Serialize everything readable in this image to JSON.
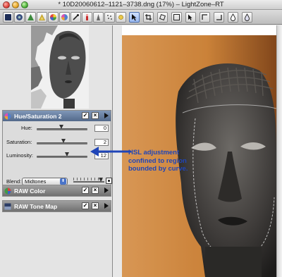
{
  "window": {
    "title": "* 10D20060612–1121–3738.dng (17%) – LightZone–RT"
  },
  "toolbar": {
    "left_tools": [
      "layers-icon",
      "channel-mixer-icon",
      "tone-curve-icon",
      "zone-mapper-icon",
      "color-balance-icon",
      "hue-saturation-icon",
      "color-picker-icon",
      "red-eye-icon",
      "sharpen-icon",
      "noise-icon",
      "relight-icon"
    ],
    "right_tools": [
      "arrow-select-icon",
      "crop-icon",
      "rotate-icon",
      "region-icon",
      "curve-region-icon",
      "polygon-region-icon",
      "spot-icon",
      "drop-icon",
      "drop-outline-icon"
    ]
  },
  "hue_saturation_panel": {
    "title": "Hue/Saturation 2",
    "checked": true,
    "hue": {
      "label": "Hue:",
      "value": "0"
    },
    "saturation": {
      "label": "Saturation:",
      "value": "2"
    },
    "luminosity": {
      "label": "Luminosity:",
      "value": "12"
    },
    "blend": {
      "label": "Blend:",
      "selected": "Midtones"
    }
  },
  "raw_color_panel": {
    "title": "RAW Color",
    "checked": true
  },
  "raw_tone_map_panel": {
    "title": "RAW Tone Map",
    "checked": true
  },
  "annotation": {
    "lines": [
      "HSL adjustment",
      "confined to region",
      "bounded by curve."
    ],
    "color": "#1f45b8"
  },
  "colors": {
    "panel_header_active": "#53698a",
    "panel_header_inactive": "#707070",
    "photo_background": "#d78a3d"
  }
}
